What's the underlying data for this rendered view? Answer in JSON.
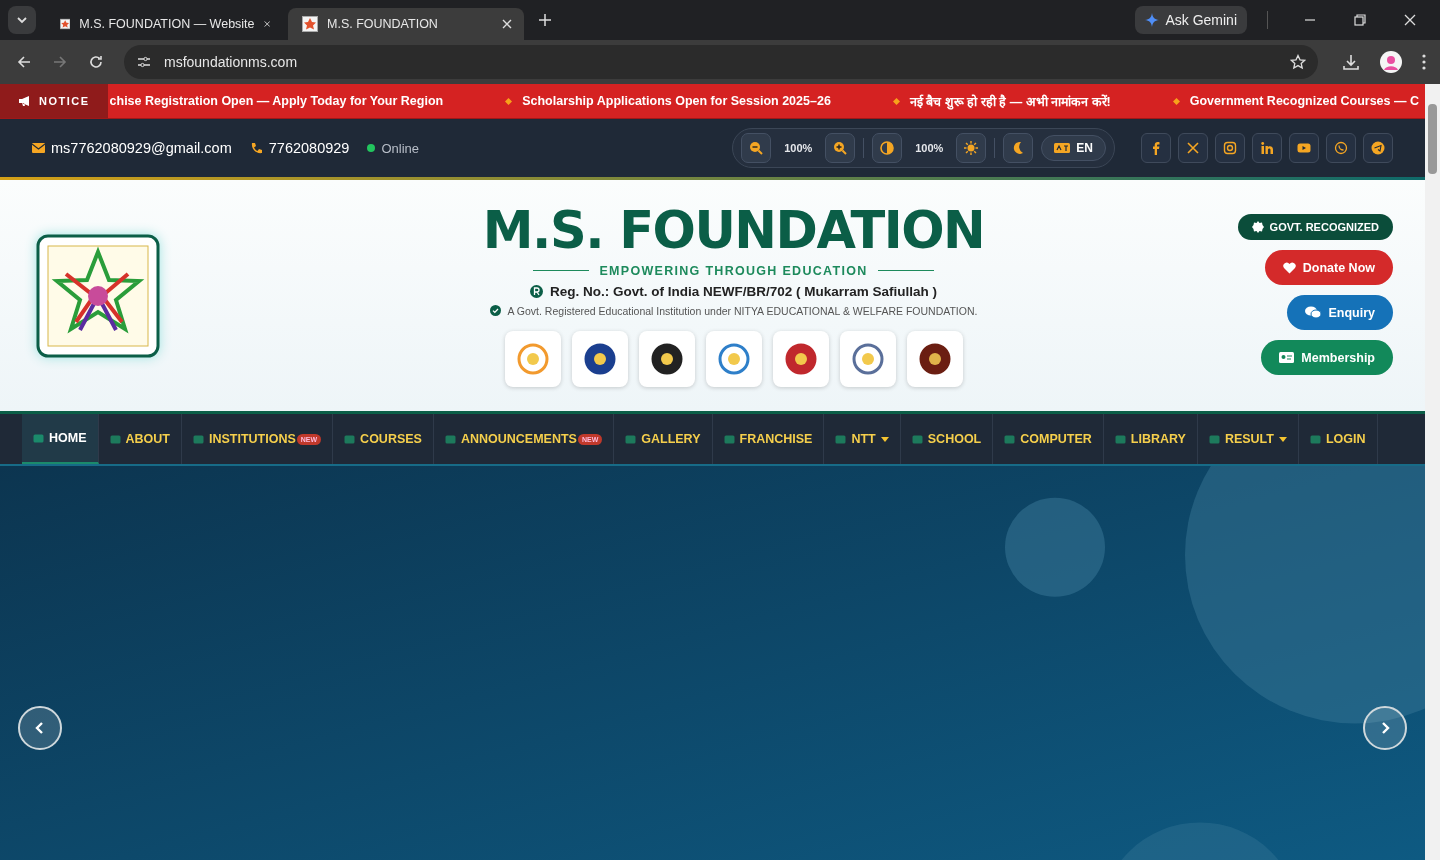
{
  "browser": {
    "tabs": [
      {
        "title": "M.S. FOUNDATION — Website",
        "selected": false
      },
      {
        "title": "M.S. FOUNDATION",
        "selected": true
      }
    ],
    "gemini": "Ask Gemini",
    "url": "msfoundationms.com"
  },
  "ticker": {
    "label": "NOTICE",
    "items": [
      "chise Registration Open — Apply Today for Your Region",
      "Scholarship Applications Open for Session 2025–26",
      "नई बैच शुरू हो रही है — अभी नामांकन करें!",
      "Government Recognized Courses — C"
    ]
  },
  "topbar": {
    "email": "ms7762080929@gmail.com",
    "phone": "7762080929",
    "status": "Online",
    "online": true,
    "zoom": "100%",
    "contrast": "100%",
    "language": "EN"
  },
  "header": {
    "title": "M.S. FOUNDATION",
    "tagline": "EMPOWERING THROUGH EDUCATION",
    "reg": "Reg. No.: Govt. of India NEWF/BR/702 ( Mukarram Safiullah )",
    "note": "A Govt. Registered Educational Institution under NITYA EDUCATIONAL & WELFARE FOUNDATION.",
    "badge": "GOVT. RECOGNIZED",
    "buttons": [
      {
        "label": "Donate Now",
        "kind": "donate"
      },
      {
        "label": "Enquiry",
        "kind": "enquiry"
      },
      {
        "label": "Membership",
        "kind": "membership"
      }
    ]
  },
  "nav": [
    {
      "label": "HOME",
      "selected": true,
      "dropdown": false
    },
    {
      "label": "ABOUT",
      "selected": false,
      "dropdown": false
    },
    {
      "label": "INSTITUTIONS",
      "selected": false,
      "badge": "NEW",
      "dropdown": false
    },
    {
      "label": "COURSES",
      "selected": false,
      "dropdown": false
    },
    {
      "label": "ANNOUNCEMENTS",
      "selected": false,
      "badge": "NEW",
      "dropdown": false
    },
    {
      "label": "GALLERY",
      "selected": false,
      "dropdown": false
    },
    {
      "label": "FRANCHISE",
      "selected": false,
      "dropdown": false
    },
    {
      "label": "NTT",
      "selected": false,
      "dropdown": true
    },
    {
      "label": "SCHOOL",
      "selected": false,
      "dropdown": false
    },
    {
      "label": "COMPUTER",
      "selected": false,
      "dropdown": false
    },
    {
      "label": "LIBRARY",
      "selected": false,
      "dropdown": false
    },
    {
      "label": "RESULT",
      "selected": false,
      "dropdown": true
    },
    {
      "label": "LOGIN",
      "selected": false,
      "dropdown": false
    }
  ]
}
